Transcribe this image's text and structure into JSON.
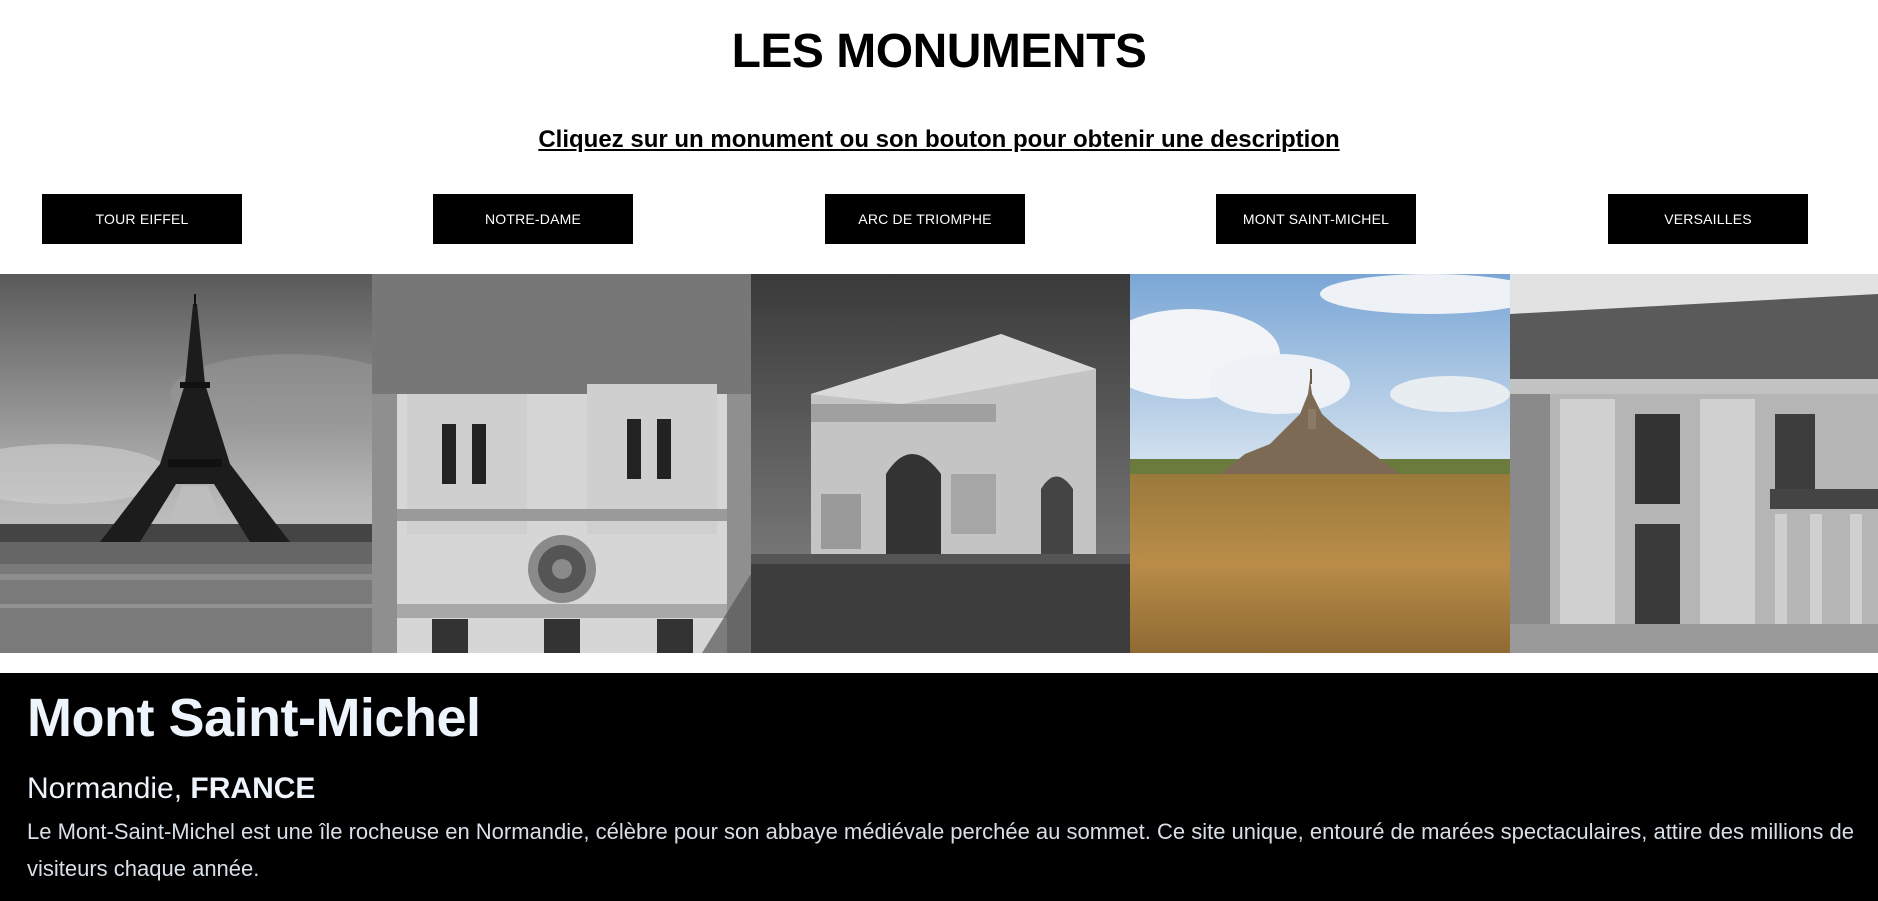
{
  "header": {
    "title": "LES MONUMENTS",
    "subtitle": "Cliquez sur un monument ou son bouton pour obtenir une description"
  },
  "buttons": [
    {
      "label": "TOUR EIFFEL"
    },
    {
      "label": "NOTRE-DAME"
    },
    {
      "label": "ARC DE TRIOMPHE"
    },
    {
      "label": "MONT SAINT-MICHEL"
    },
    {
      "label": "VERSAILLES"
    }
  ],
  "gallery": [
    {
      "name": "eiffel-tower-photo",
      "tone": "grayscale"
    },
    {
      "name": "notre-dame-photo",
      "tone": "grayscale"
    },
    {
      "name": "arc-de-triomphe-photo",
      "tone": "grayscale"
    },
    {
      "name": "mont-saint-michel-photo",
      "tone": "color",
      "selected": true
    },
    {
      "name": "versailles-photo",
      "tone": "grayscale"
    }
  ],
  "description": {
    "title": "Mont Saint-Michel",
    "region": "Normandie,",
    "country": "FRANCE",
    "text": "Le Mont-Saint-Michel est une île rocheuse en Normandie, célèbre pour son abbaye médiévale perchée au sommet. Ce site unique, entouré de marées spectaculaires, attire des millions de visiteurs chaque année."
  },
  "colors": {
    "background": "#ffffff",
    "button_bg": "#000000",
    "button_text": "#ffffff",
    "panel_bg": "#000000",
    "panel_text": "#eef4fb"
  }
}
